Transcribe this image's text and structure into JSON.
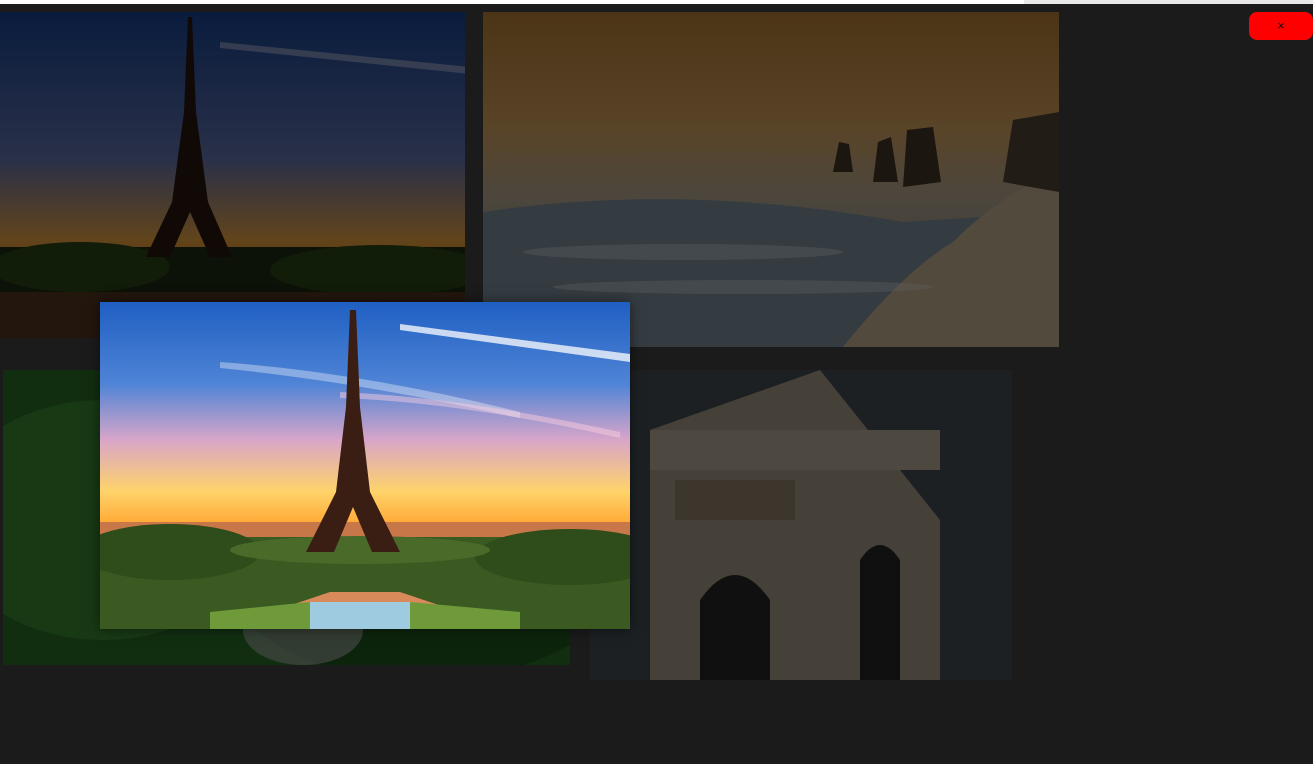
{
  "toolbar": {
    "close_label": "×",
    "close_color": "#ff0000",
    "close_icon": "close-icon"
  },
  "progress": {
    "loaded_fraction": 0.78
  },
  "gallery": {
    "background": "#1b1b1b",
    "dim_overlay": "rgba(0,0,0,0.62)",
    "thumbnails": [
      {
        "subject": "eiffel-tower-sunset"
      },
      {
        "subject": "coastal-rock-stacks-beach"
      },
      {
        "subject": "green-foliage"
      },
      {
        "subject": "arc-de-triomphe"
      }
    ],
    "viewer": {
      "subject": "eiffel-tower-sunset"
    }
  }
}
